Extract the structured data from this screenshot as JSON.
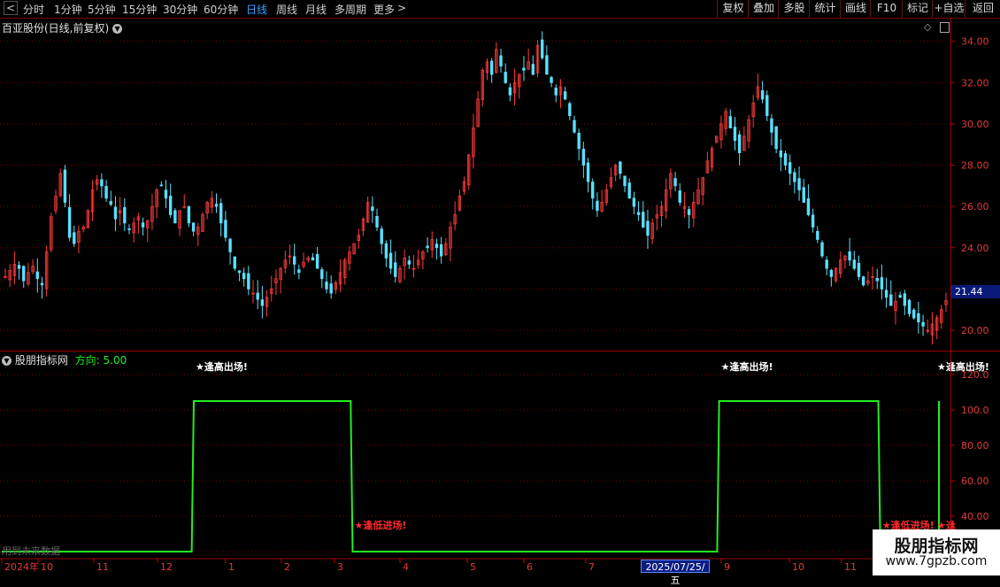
{
  "toolbar": {
    "periods": [
      {
        "label": "分时",
        "active": false
      },
      {
        "label": "1分钟",
        "active": false
      },
      {
        "label": "5分钟",
        "active": false
      },
      {
        "label": "15分钟",
        "active": false
      },
      {
        "label": "30分钟",
        "active": false
      },
      {
        "label": "60分钟",
        "active": false
      },
      {
        "label": "日线",
        "active": true
      },
      {
        "label": "周线",
        "active": false
      },
      {
        "label": "月线",
        "active": false
      },
      {
        "label": "多周期",
        "active": false
      },
      {
        "label": "更多",
        "active": false
      }
    ],
    "more_arrow": ">",
    "back_arrow": "<",
    "right_buttons": [
      "复权",
      "叠加",
      "多股",
      "统计",
      "画线",
      "F10",
      "标记",
      "+自选",
      "返回"
    ]
  },
  "main_chart": {
    "title": "百亚股份(日线,前复权)",
    "dropdown_icon": "chevron-down-icon",
    "current_price": "21.44",
    "y_ticks": [
      "34.00",
      "32.00",
      "30.00",
      "28.00",
      "26.00",
      "24.00",
      "22.00",
      "20.00"
    ],
    "y_range": [
      19.1,
      35.1
    ],
    "up_color": "#ff3a3a",
    "down_color": "#5ae0ff"
  },
  "indicator": {
    "name": "股朋指标网",
    "direction_label": "方向: 5.00",
    "y_ticks": [
      "120.0",
      "100.0",
      "80.00",
      "60.00",
      "40.00",
      "20.00"
    ],
    "line_color": "#22ee22",
    "signal_high": "★逢高出场!",
    "signal_low": "★逢低进场!",
    "signal_low_cut": "★逢",
    "high_color": "#ffffff",
    "low_color": "#ff2a2a"
  },
  "x_axis": {
    "labels": [
      "2024年",
      "10",
      "11",
      "12",
      "1",
      "2",
      "3",
      "4",
      "5",
      "6",
      "7",
      "9",
      "10",
      "11"
    ],
    "selected_date": "2025/07/25/五"
  },
  "footer_note": "用到未来数据",
  "watermark": {
    "title": "股朋指标网",
    "url": "www.7gpzb.com"
  },
  "chart_data": [
    {
      "type": "candlestick",
      "title": "百亚股份(日线,前复权)",
      "ylim": [
        19.1,
        35.1
      ],
      "x_labels": [
        "2024年",
        "10",
        "11",
        "12",
        "1",
        "2",
        "3",
        "4",
        "5",
        "6",
        "7",
        "9",
        "10",
        "11"
      ],
      "close_path": [
        22.6,
        22.9,
        23.2,
        23.0,
        22.4,
        22.8,
        23.1,
        22.5,
        22.2,
        23.8,
        25.5,
        26.5,
        27.6,
        26.2,
        24.5,
        24.2,
        24.8,
        25.0,
        25.8,
        26.8,
        27.3,
        27.0,
        26.4,
        26.1,
        25.4,
        25.8,
        25.2,
        24.9,
        25.2,
        25.5,
        25.0,
        25.3,
        26.0,
        26.8,
        27.0,
        26.4,
        25.6,
        25.2,
        25.8,
        26.0,
        25.2,
        24.8,
        25.0,
        25.6,
        26.2,
        26.4,
        26.0,
        25.2,
        24.5,
        23.8,
        23.0,
        22.8,
        22.5,
        22.0,
        21.8,
        21.5,
        21.2,
        21.6,
        22.0,
        22.5,
        23.0,
        23.4,
        23.6,
        23.2,
        22.8,
        23.3,
        23.5,
        23.4,
        23.0,
        22.5,
        22.0,
        21.8,
        22.3,
        22.8,
        23.4,
        23.8,
        24.2,
        24.6,
        25.4,
        26.2,
        25.8,
        25.0,
        24.2,
        23.5,
        23.0,
        22.6,
        23.0,
        23.5,
        23.2,
        23.0,
        23.4,
        23.8,
        24.0,
        24.4,
        24.0,
        23.6,
        24.2,
        25.0,
        25.6,
        26.5,
        27.2,
        28.5,
        29.8,
        31.2,
        32.6,
        33.0,
        32.4,
        33.6,
        32.8,
        32.0,
        31.4,
        32.0,
        32.4,
        32.6,
        33.0,
        32.4,
        33.8,
        33.2,
        32.4,
        32.0,
        31.4,
        31.8,
        31.2,
        30.4,
        29.6,
        28.8,
        28.0,
        27.2,
        26.4,
        25.8,
        26.2,
        26.8,
        27.4,
        28.0,
        27.6,
        27.0,
        26.4,
        26.0,
        25.6,
        25.0,
        24.6,
        25.2,
        25.6,
        26.0,
        26.8,
        27.6,
        27.0,
        26.2,
        26.0,
        25.6,
        26.2,
        26.8,
        27.4,
        28.2,
        28.8,
        29.4,
        30.0,
        30.6,
        29.8,
        29.2,
        28.6,
        29.4,
        30.2,
        31.0,
        31.8,
        31.2,
        30.4,
        29.6,
        28.8,
        28.4,
        28.0,
        27.6,
        27.2,
        26.8,
        26.2,
        25.6,
        25.0,
        24.4,
        23.6,
        23.0,
        22.6,
        23.0,
        23.4,
        23.6,
        23.4,
        23.0,
        22.6,
        22.2,
        22.4,
        22.6,
        22.4,
        22.0,
        21.6,
        21.2,
        21.4,
        21.6,
        21.2,
        20.8,
        20.6,
        20.4,
        20.2,
        20.0,
        20.3,
        20.6,
        21.0,
        21.44
      ]
    },
    {
      "type": "line",
      "title": "股朋指标网",
      "ylim": [
        16.5,
        133.0
      ],
      "series": [
        {
          "name": "方向",
          "segments": [
            [
              0,
              20
            ],
            [
              0.2004,
              20
            ],
            [
              0.2026,
              105
            ],
            [
              0.3681,
              105
            ],
            [
              0.3702,
              20
            ],
            [
              0.7548,
              20
            ],
            [
              0.7569,
              105
            ],
            [
              0.9248,
              105
            ],
            [
              0.927,
              20
            ],
            [
              1.1046,
              20
            ],
            [
              1.1068,
              105
            ],
            [
              1.4046,
              105
            ],
            [
              1.4068,
              20
            ]
          ]
        }
      ],
      "signals": [
        {
          "at": 0.2026,
          "text": "★逢高出场!"
        },
        {
          "at": 0.3702,
          "text": "★逢低进场!"
        },
        {
          "at": 0.7569,
          "text": "★逢高出场!"
        },
        {
          "at": 0.927,
          "text": "★逢低进场!"
        },
        {
          "at": 1.1068,
          "text": "★逢高出场!"
        },
        {
          "at": 1.4068,
          "text": "★逢"
        }
      ]
    }
  ]
}
